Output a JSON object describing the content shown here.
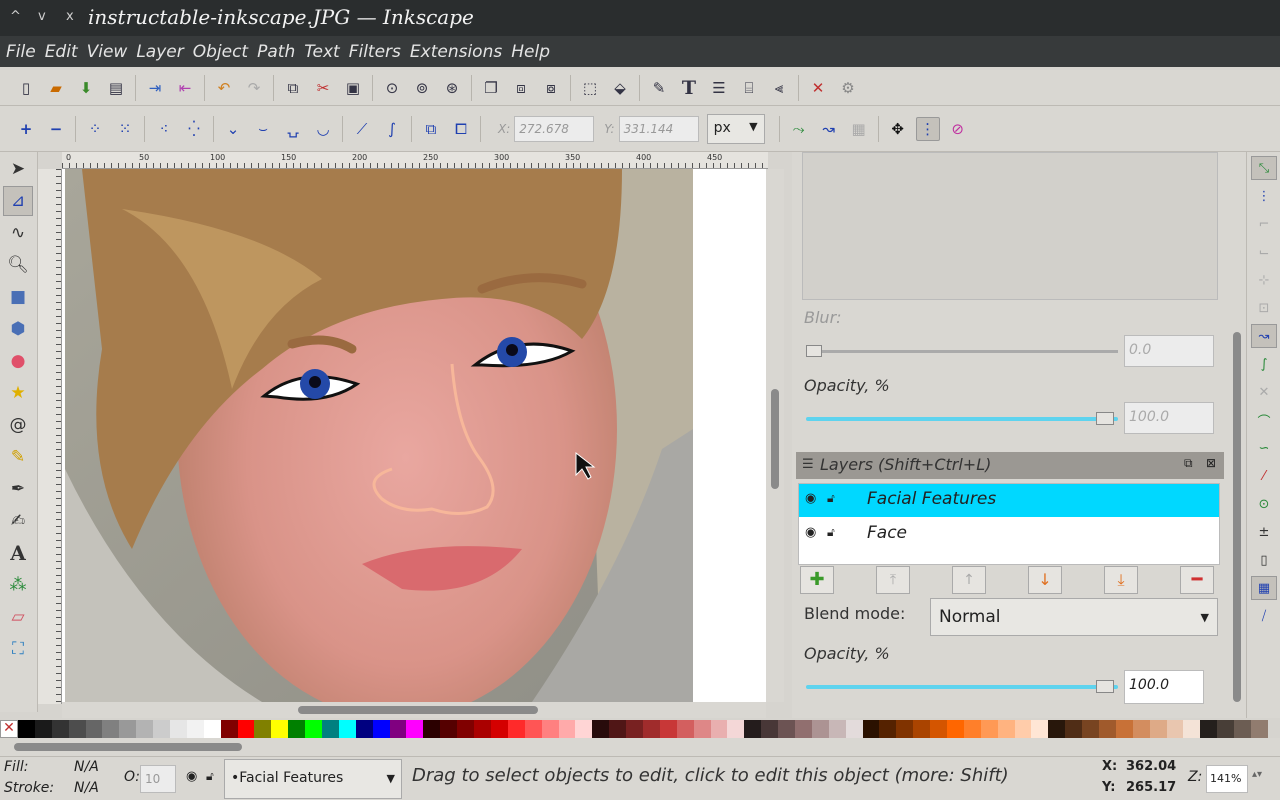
{
  "window": {
    "title": "instructable-inkscape.JPG — Inkscape",
    "btn_up": "^",
    "btn_down": "v",
    "btn_close": "x"
  },
  "menu": [
    "File",
    "Edit",
    "View",
    "Layer",
    "Object",
    "Path",
    "Text",
    "Filters",
    "Extensions",
    "Help"
  ],
  "node_toolbar": {
    "x_label": "X:",
    "x_value": "272.678",
    "y_label": "Y:",
    "y_value": "331.144",
    "unit": "px"
  },
  "ruler": {
    "h_ticks": [
      "0",
      "50",
      "100",
      "150",
      "200",
      "250",
      "300",
      "350",
      "400",
      "450"
    ]
  },
  "fill_stroke": {
    "blur_label": "Blur:",
    "blur_value": "0.0",
    "opacity_label": "Opacity, %",
    "opacity_value": "100.0",
    "opacity_fraction": 1.0
  },
  "layers": {
    "panel_title": "Layers (Shift+Ctrl+L)",
    "items": [
      {
        "name": "Facial Features",
        "selected": true
      },
      {
        "name": "Face",
        "selected": false
      }
    ],
    "blend_label": "Blend mode:",
    "blend_value": "Normal",
    "opacity_label": "Opacity, %",
    "opacity_value": "100.0",
    "opacity_fraction": 1.0
  },
  "status": {
    "fill_label": "Fill:",
    "fill_value": "N/A",
    "stroke_label": "Stroke:",
    "stroke_value": "N/A",
    "o_label": "O:",
    "o_value": "10",
    "current_layer": "•Facial Features",
    "message": "Drag to select objects to edit, click to edit this object (more: Shift)",
    "x_label": "X:",
    "x_value": "362.04",
    "y_label": "Y:",
    "y_value": "265.17",
    "z_label": "Z:",
    "zoom": "141%"
  },
  "colors": {
    "accent_selection": "#00d8ff",
    "nose_path": "#f7b79a",
    "eye_iris": "#2449a8"
  },
  "palette": [
    "#000000",
    "#1a1a1a",
    "#333333",
    "#4d4d4d",
    "#666666",
    "#808080",
    "#999999",
    "#b3b3b3",
    "#cccccc",
    "#e6e6e6",
    "#f2f2f2",
    "#ffffff",
    "#800000",
    "#ff0000",
    "#808000",
    "#ffff00",
    "#008000",
    "#00ff00",
    "#008080",
    "#00ffff",
    "#000080",
    "#0000ff",
    "#800080",
    "#ff00ff",
    "#2b0000",
    "#550000",
    "#800000",
    "#aa0000",
    "#d40000",
    "#ff2a2a",
    "#ff5555",
    "#ff8080",
    "#ffaaaa",
    "#ffd5d5",
    "#280b0b",
    "#501616",
    "#782121",
    "#a02c2c",
    "#c83737",
    "#d35f5f",
    "#de8787",
    "#e9afaf",
    "#f4d7d7",
    "#241c1c",
    "#483737",
    "#6c5353",
    "#916f6f",
    "#ac9393",
    "#c8b7b7",
    "#e3dbdb",
    "#2b1100",
    "#552200",
    "#803300",
    "#aa4400",
    "#d45500",
    "#ff6600",
    "#ff7f2a",
    "#ff9955",
    "#ffb380",
    "#ffccaa",
    "#ffe6d5",
    "#28170b",
    "#502d16",
    "#784421",
    "#a05a2c",
    "#c87137",
    "#d38d5f",
    "#deaa87",
    "#e9c6af",
    "#f4e3d7",
    "#241f1c",
    "#483e37",
    "#6c5d53",
    "#917c6f"
  ]
}
